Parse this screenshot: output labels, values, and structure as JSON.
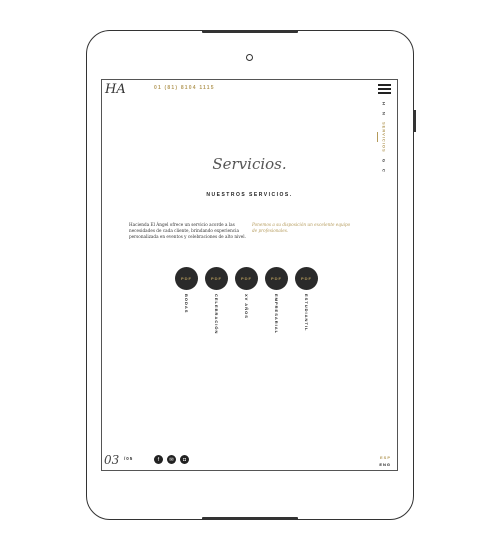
{
  "header": {
    "logo": "HA",
    "phone": "01 (81) 8104 1115"
  },
  "nav": {
    "items": [
      {
        "label": "H"
      },
      {
        "label": "N"
      },
      {
        "label": "SERVICIOS",
        "active": true
      },
      {
        "label": "G"
      },
      {
        "label": "C"
      }
    ]
  },
  "main": {
    "title": "Servicios.",
    "subtitle": "NUESTROS SERVICIOS.",
    "description": "Hacienda El Ángel ofrece un servicio acorde a las necesidades de cada cliente, brindando experiencia personalizada en eventos y celebraciones de alto nivel.",
    "tagline": "Ponemos a su disposición un excelente equipo de profesionales.",
    "services": [
      {
        "badge": "PDF",
        "label": "BODAS"
      },
      {
        "badge": "PDF",
        "label": "CELEBRACIÓN"
      },
      {
        "badge": "PDF",
        "label": "XV AÑOS"
      },
      {
        "badge": "PDF",
        "label": "EMPRESARIAL"
      },
      {
        "badge": "PDF",
        "label": "ESTUDIANTIL"
      }
    ]
  },
  "footer": {
    "page": "03",
    "total": "/05",
    "social": [
      "facebook-icon",
      "email-icon",
      "instagram-icon"
    ],
    "lang": {
      "esp": "ESP",
      "eng": "ENG"
    }
  },
  "colors": {
    "accent": "#b49a5a",
    "dark": "#2a2a2a"
  }
}
